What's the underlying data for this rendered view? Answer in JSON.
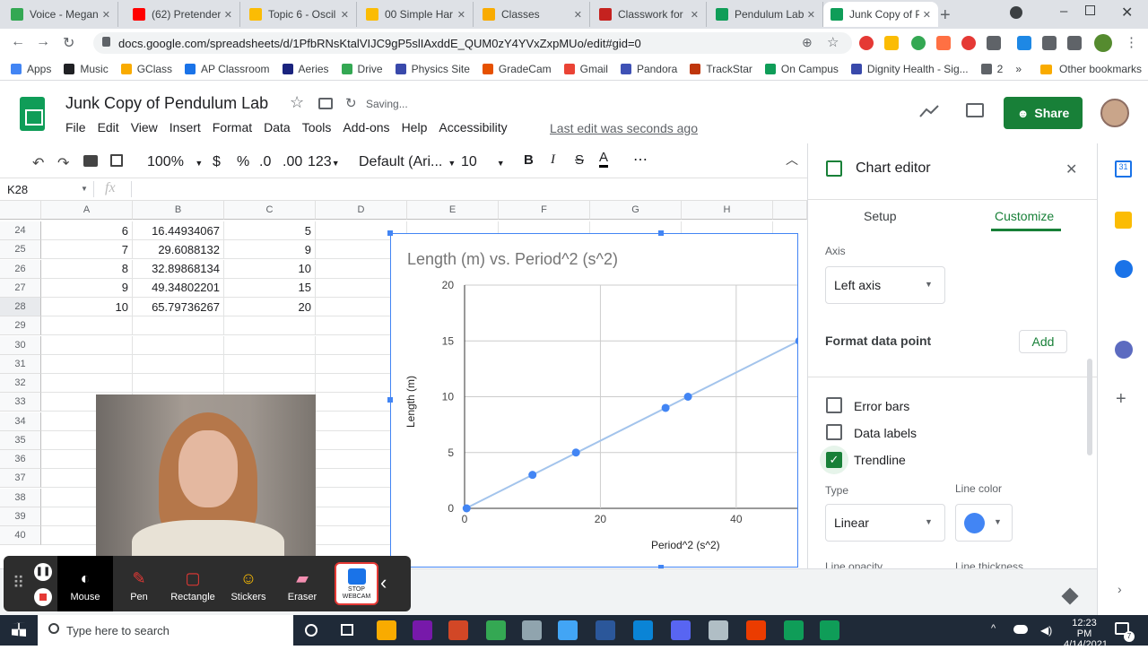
{
  "browser": {
    "tabs": [
      {
        "label": "Voice - Megan",
        "color": "#34a853"
      },
      {
        "label": "(62) Pretender",
        "color": "#ff0000"
      },
      {
        "label": "Topic 6 - Oscil",
        "color": "#fbbc04"
      },
      {
        "label": "00 Simple Har",
        "color": "#fbbc04"
      },
      {
        "label": "Classes",
        "color": "#f9ab00"
      },
      {
        "label": "Classwork for",
        "color": "#c5221f"
      },
      {
        "label": "Pendulum Lab",
        "color": "#0f9d58"
      },
      {
        "label": "Junk Copy of P",
        "color": "#0f9d58"
      }
    ],
    "url": "docs.google.com/spreadsheets/d/1PfbRNsKtalVIJC9gP5slIAxddE_QUM0zY4YVxZxpMUo/edit#gid=0",
    "bookmarks": [
      {
        "label": "Apps",
        "color": "#4285f4"
      },
      {
        "label": "Music",
        "color": "#202124"
      },
      {
        "label": "GClass",
        "color": "#f9ab00"
      },
      {
        "label": "AP Classroom",
        "color": "#1a73e8"
      },
      {
        "label": "Aeries",
        "color": "#1a237e"
      },
      {
        "label": "Drive",
        "color": "#34a853"
      },
      {
        "label": "Physics Site",
        "color": "#3949ab"
      },
      {
        "label": "GradeCam",
        "color": "#e65100"
      },
      {
        "label": "Gmail",
        "color": "#ea4335"
      },
      {
        "label": "Pandora",
        "color": "#3f51b5"
      },
      {
        "label": "TrackStar",
        "color": "#bf360c"
      },
      {
        "label": "On Campus",
        "color": "#0f9d58"
      },
      {
        "label": "Dignity Health - Sig...",
        "color": "#3949ab"
      },
      {
        "label": "2",
        "color": "#5f6368"
      }
    ],
    "other_bookmarks": "Other bookmarks"
  },
  "sheets": {
    "title": "Junk Copy of Pendulum Lab",
    "saving": "Saving...",
    "menus": [
      "File",
      "Edit",
      "View",
      "Insert",
      "Format",
      "Data",
      "Tools",
      "Add-ons",
      "Help",
      "Accessibility"
    ],
    "last_edit": "Last edit was seconds ago",
    "share": "Share",
    "toolbar": {
      "zoom": "100%",
      "currency": "$",
      "percent": "%",
      "dec_less": ".0",
      "dec_more": ".00",
      "format": "123",
      "font": "Default (Ari...",
      "size": "10",
      "more": "⋯"
    },
    "cell_ref": "K28",
    "fx": "fx",
    "columns": [
      "A",
      "B",
      "C",
      "D",
      "E",
      "F",
      "G",
      "H"
    ],
    "rows": [
      {
        "n": "24",
        "a": "6",
        "b": "16.44934067",
        "c": "5"
      },
      {
        "n": "25",
        "a": "7",
        "b": "29.6088132",
        "c": "9"
      },
      {
        "n": "26",
        "a": "8",
        "b": "32.89868134",
        "c": "10"
      },
      {
        "n": "27",
        "a": "9",
        "b": "49.34802201",
        "c": "15"
      },
      {
        "n": "28",
        "a": "10",
        "b": "65.79736267",
        "c": "20"
      },
      {
        "n": "29",
        "a": "",
        "b": "",
        "c": ""
      },
      {
        "n": "30",
        "a": "",
        "b": "",
        "c": ""
      },
      {
        "n": "31",
        "a": "",
        "b": "",
        "c": ""
      },
      {
        "n": "32",
        "a": "",
        "b": "",
        "c": ""
      },
      {
        "n": "33",
        "a": "",
        "b": "",
        "c": ""
      },
      {
        "n": "34",
        "a": "",
        "b": "",
        "c": ""
      },
      {
        "n": "35",
        "a": "",
        "b": "",
        "c": ""
      },
      {
        "n": "36",
        "a": "",
        "b": "",
        "c": ""
      },
      {
        "n": "37",
        "a": "",
        "b": "",
        "c": ""
      },
      {
        "n": "38",
        "a": "",
        "b": "",
        "c": ""
      },
      {
        "n": "39",
        "a": "",
        "b": "",
        "c": ""
      },
      {
        "n": "40",
        "a": "",
        "b": "",
        "c": ""
      }
    ]
  },
  "chart_data": {
    "type": "scatter",
    "title": "Length (m) vs. Period^2 (s^2)",
    "xlabel": "Period^2 (s^2)",
    "ylabel": "Length (m)",
    "xlim": [
      0,
      49
    ],
    "ylim": [
      0,
      20
    ],
    "xticks": [
      "0",
      "20",
      "40"
    ],
    "yticks": [
      "0",
      "5",
      "10",
      "15",
      "20"
    ],
    "series": [
      {
        "points": [
          [
            0.3,
            0
          ],
          [
            10,
            3
          ],
          [
            16.4,
            5
          ],
          [
            29.6,
            9
          ],
          [
            32.9,
            10
          ],
          [
            49.3,
            15
          ]
        ]
      }
    ],
    "trendline": true,
    "grid": true,
    "point_color": "#4285f4",
    "line_color": "#a3c4ec"
  },
  "editor": {
    "title": "Chart editor",
    "tab_setup": "Setup",
    "tab_customize": "Customize",
    "axis_label": "Axis",
    "axis_value": "Left axis",
    "format_point": "Format data point",
    "add": "Add",
    "error_bars": "Error bars",
    "data_labels": "Data labels",
    "trendline": "Trendline",
    "type_label": "Type",
    "type_value": "Linear",
    "line_color_label": "Line color",
    "line_opacity": "Line opacity",
    "line_thickness": "Line thickness",
    "accent": "#188038",
    "swatch": "#4285f4"
  },
  "recorder": {
    "tools": [
      "Mouse",
      "Pen",
      "Rectangle",
      "Stickers",
      "Eraser"
    ],
    "stop": "STOP WEBCAM"
  },
  "taskbar": {
    "search": "Type here to search",
    "time": "12:23 PM",
    "date": "4/14/2021",
    "notifications": "7"
  }
}
